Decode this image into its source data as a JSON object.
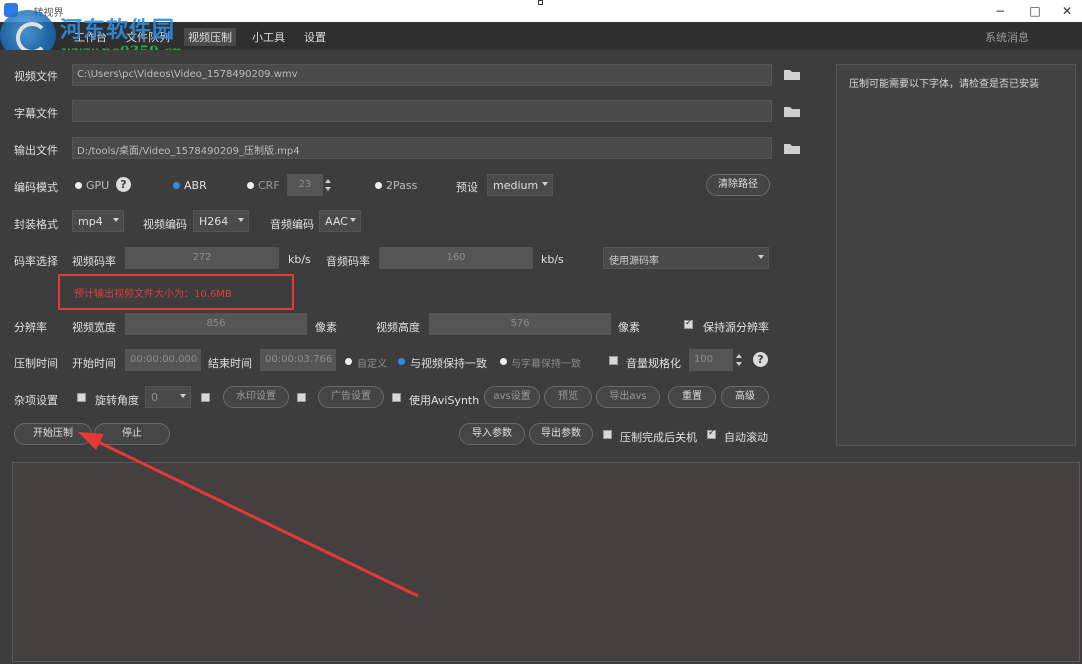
{
  "window": {
    "title": "...转视界",
    "minimize": "−",
    "maximize": "□",
    "close": "✕"
  },
  "watermark": {
    "site": "河东软件园",
    "url": "www.pc0359.cn"
  },
  "tabs": [
    {
      "label": "工作台"
    },
    {
      "label": "文件队列"
    },
    {
      "label": "视频压制"
    },
    {
      "label": "小工具"
    },
    {
      "label": "设置"
    }
  ],
  "active_tab": "视频压制",
  "system_message": "系统消息",
  "form": {
    "video_file_label": "视频文件",
    "video_file_value": "C:\\Users\\pc\\Videos\\Video_1578490209.wmv",
    "subtitle_file_label": "字幕文件",
    "subtitle_file_value": "",
    "output_file_label": "输出文件",
    "output_file_value": "D:/tools/桌面/Video_1578490209_压制版.mp4",
    "encode_mode_label": "编码模式",
    "gpu_label": "GPU",
    "abr_label": "ABR",
    "crf_label": "CRF",
    "crf_value": "23",
    "twopass_label": "2Pass",
    "preset_label": "预设",
    "preset_value": "medium",
    "clear_path_button": "清除路径",
    "container_label": "封装格式",
    "container_value": "mp4",
    "video_codec_label": "视频编码",
    "video_codec_value": "H264",
    "audio_codec_label": "音频编码",
    "audio_codec_value": "AAC",
    "bitrate_label": "码率选择",
    "video_bitrate_label": "视频码率",
    "video_bitrate_value": "272",
    "kbs_unit_1": "kb/s",
    "audio_bitrate_label": "音频码率",
    "audio_bitrate_value": "160",
    "kbs_unit_2": "kb/s",
    "source_bitrate_option": "使用源码率",
    "warning_text": "预计输出视频文件大小为：10.6MB",
    "resolution_label": "分辨率",
    "video_width_label": "视频宽度",
    "video_width_value": "856",
    "pixel_unit_1": "像素",
    "video_height_label": "视频高度",
    "video_height_value": "576",
    "pixel_unit_2": "像素",
    "keep_resolution_label": "保持源分辨率",
    "time_label": "压制时间",
    "start_time_label": "开始时间",
    "start_time_value": "00:00:00.000",
    "end_time_label": "结束时间",
    "end_time_value": "00:00:03.766",
    "custom_label": "自定义",
    "keep_video_label": "与视频保持一致",
    "keep_subtitle_label": "与字幕保持一致",
    "volume_normalize_label": "音量规格化",
    "volume_value": "100",
    "misc_label": "杂项设置",
    "rotate_label": "旋转角度",
    "rotate_value": "0",
    "watermark_button": "水印设置",
    "ad_button": "广告设置",
    "avisynth_label": "使用AviSynth",
    "avs_settings_button": "avs设置",
    "preview_button": "预览",
    "export_avs_button": "导出avs",
    "reset_button": "重置",
    "advanced_button": "高级",
    "start_button": "开始压制",
    "stop_button": "停止",
    "import_params_button": "导入参数",
    "export_params_button": "导出参数",
    "shutdown_label": "压制完成后关机",
    "autoscroll_label": "自动滚动"
  },
  "right_panel": {
    "text": "压制可能需要以下字体，请检查是否已安装"
  },
  "colors": {
    "accent": "#2f8ee0",
    "warning": "#e53935",
    "background": "#3d3d3d"
  }
}
